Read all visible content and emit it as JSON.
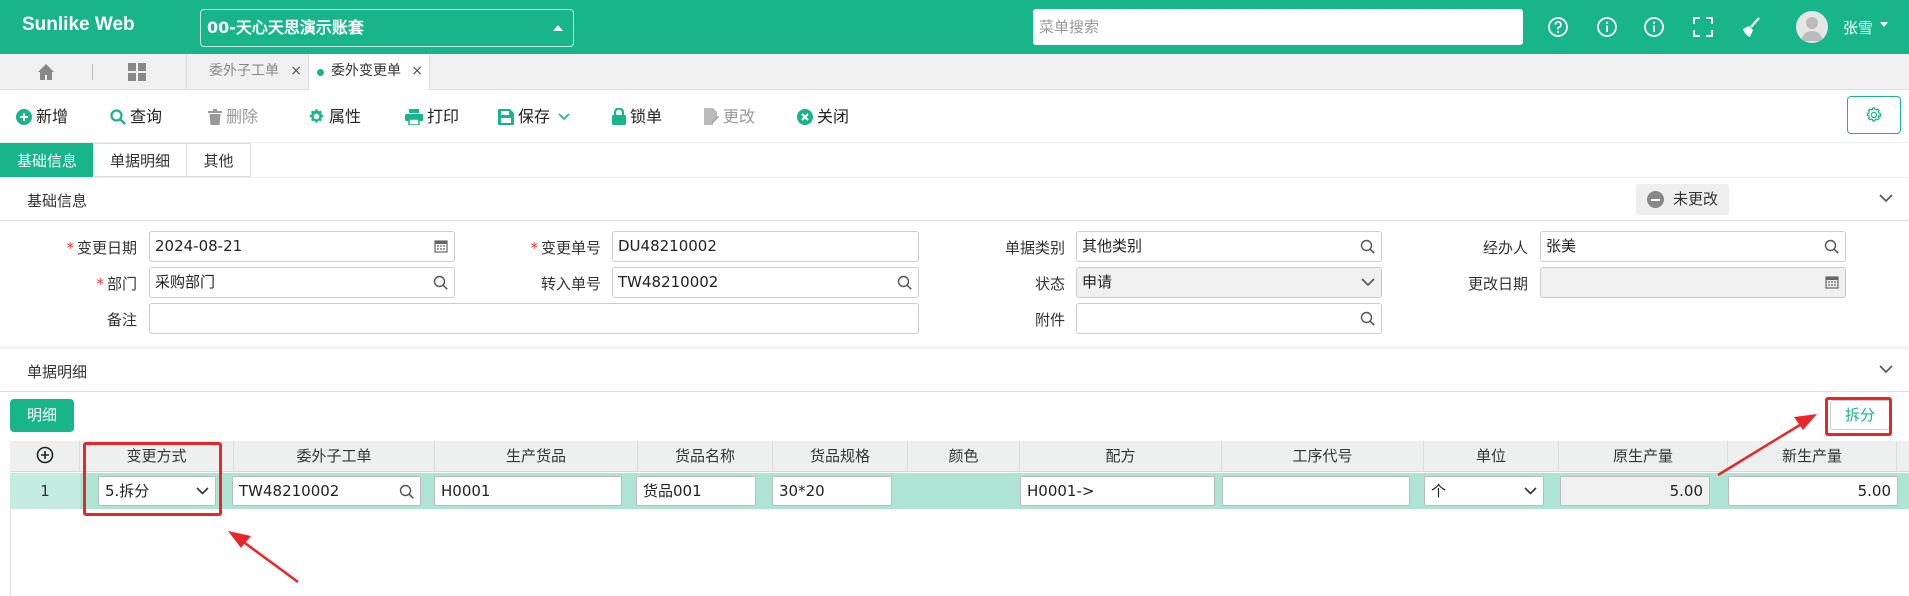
{
  "app": {
    "brand": "Sunlike Web",
    "account": "00-天心天思演示账套",
    "search_placeholder": "菜单搜索",
    "user": "张雪"
  },
  "tabs": [
    {
      "label": "委外子工单",
      "active": false
    },
    {
      "label": "委外变更单",
      "active": true
    }
  ],
  "toolbar": {
    "add": "新增",
    "query": "查询",
    "delete": "删除",
    "properties": "属性",
    "print": "打印",
    "save": "保存",
    "lock": "锁单",
    "modify": "更改",
    "close": "关闭"
  },
  "section_tabs": [
    "基础信息",
    "单据明细",
    "其他"
  ],
  "basic": {
    "title": "基础信息",
    "status_badge": "未更改",
    "fields": {
      "change_date": {
        "label": "变更日期",
        "value": "2024-08-21"
      },
      "change_no": {
        "label": "变更单号",
        "value": "DU48210002"
      },
      "doc_type": {
        "label": "单据类别",
        "value": "其他类别"
      },
      "handler": {
        "label": "经办人",
        "value": "张美"
      },
      "dept": {
        "label": "部门",
        "value": "采购部门"
      },
      "transfer_no": {
        "label": "转入单号",
        "value": "TW48210002"
      },
      "status": {
        "label": "状态",
        "value": "申请"
      },
      "modify_date": {
        "label": "更改日期",
        "value": ""
      },
      "remark": {
        "label": "备注",
        "value": ""
      },
      "attachment": {
        "label": "附件",
        "value": ""
      }
    }
  },
  "detail": {
    "title": "单据明细",
    "sub_button": "明细",
    "split_button": "拆分",
    "columns": [
      "变更方式",
      "委外子工单",
      "生产货品",
      "货品名称",
      "货品规格",
      "颜色",
      "配方",
      "工序代号",
      "单位",
      "原生产量",
      "新生产量"
    ],
    "rows": [
      {
        "no": "1",
        "change_mode": "5.拆分",
        "sub_order": "TW48210002",
        "product": "H0001",
        "product_name": "货品001",
        "spec": "30*20",
        "color": "",
        "formula": "H0001->",
        "process_code": "",
        "unit": "个",
        "orig_qty": "5.00",
        "new_qty": "5.00"
      }
    ]
  },
  "colors": {
    "accent": "#18b48a",
    "annotation": "#e8262a"
  }
}
